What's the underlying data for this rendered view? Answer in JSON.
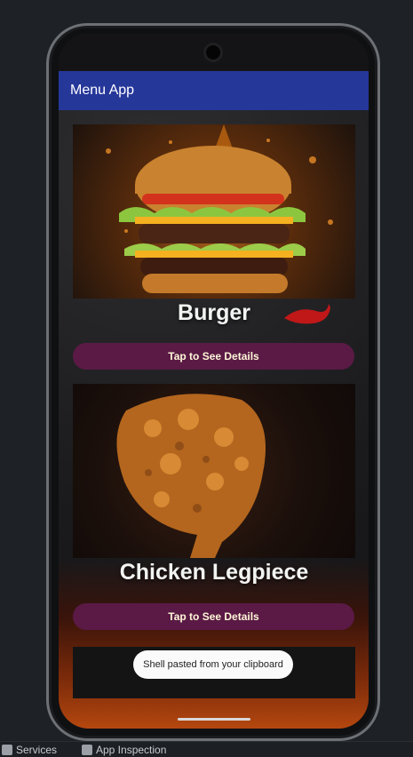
{
  "app": {
    "title": "Menu App"
  },
  "items": [
    {
      "name": "Burger",
      "button_label": "Tap to See Details",
      "image_icon": "burger-image"
    },
    {
      "name": "Chicken Legpiece",
      "button_label": "Tap to See Details",
      "image_icon": "fried-chicken-image"
    }
  ],
  "toast": {
    "text": "Shell pasted from your clipboard"
  },
  "ide": {
    "tabs": [
      {
        "label": "Services",
        "icon": "services-icon"
      },
      {
        "label": "App Inspection",
        "icon": "app-inspection-icon"
      }
    ]
  },
  "colors": {
    "app_bar": "#26379a",
    "button": "#5a1a45",
    "button_text": "#fff6d8",
    "title_text": "#f2f4f2"
  }
}
